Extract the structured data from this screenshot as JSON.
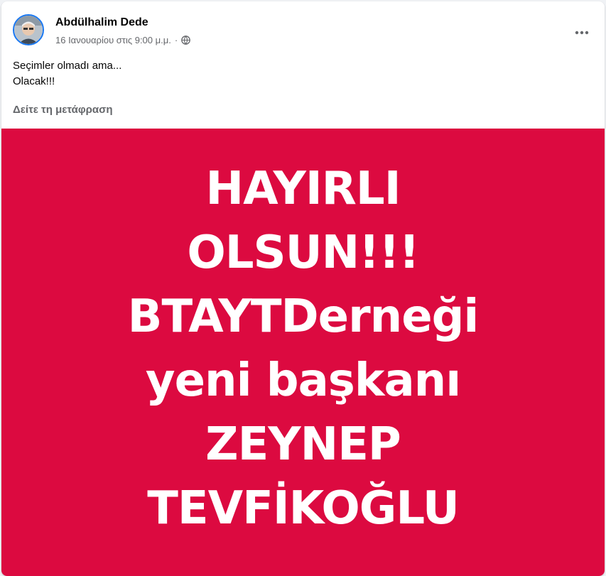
{
  "post": {
    "author": "Abdülhalim Dede",
    "date": "16 Ιανουαρίου στις 9:00 μ.μ.",
    "separator": "·",
    "privacy_icon": "globe-icon",
    "more_icon": "more-horizontal-icon",
    "text_lines": [
      "Seçimler olmadı ama...",
      "Olacak!!!"
    ],
    "translate_label": "Δείτε τη μετάφραση",
    "image": {
      "background_color": "#dc0a40",
      "text_color": "#ffffff",
      "lines": [
        "HAYIRLI",
        "OLSUN!!!",
        "BTAYTDerneği",
        "yeni başkanı",
        "ZEYNEP",
        "TEVFİKOĞLU"
      ]
    }
  },
  "colors": {
    "accent": "#1877f2",
    "secondary_text": "#65676b",
    "primary_text": "#050505"
  }
}
